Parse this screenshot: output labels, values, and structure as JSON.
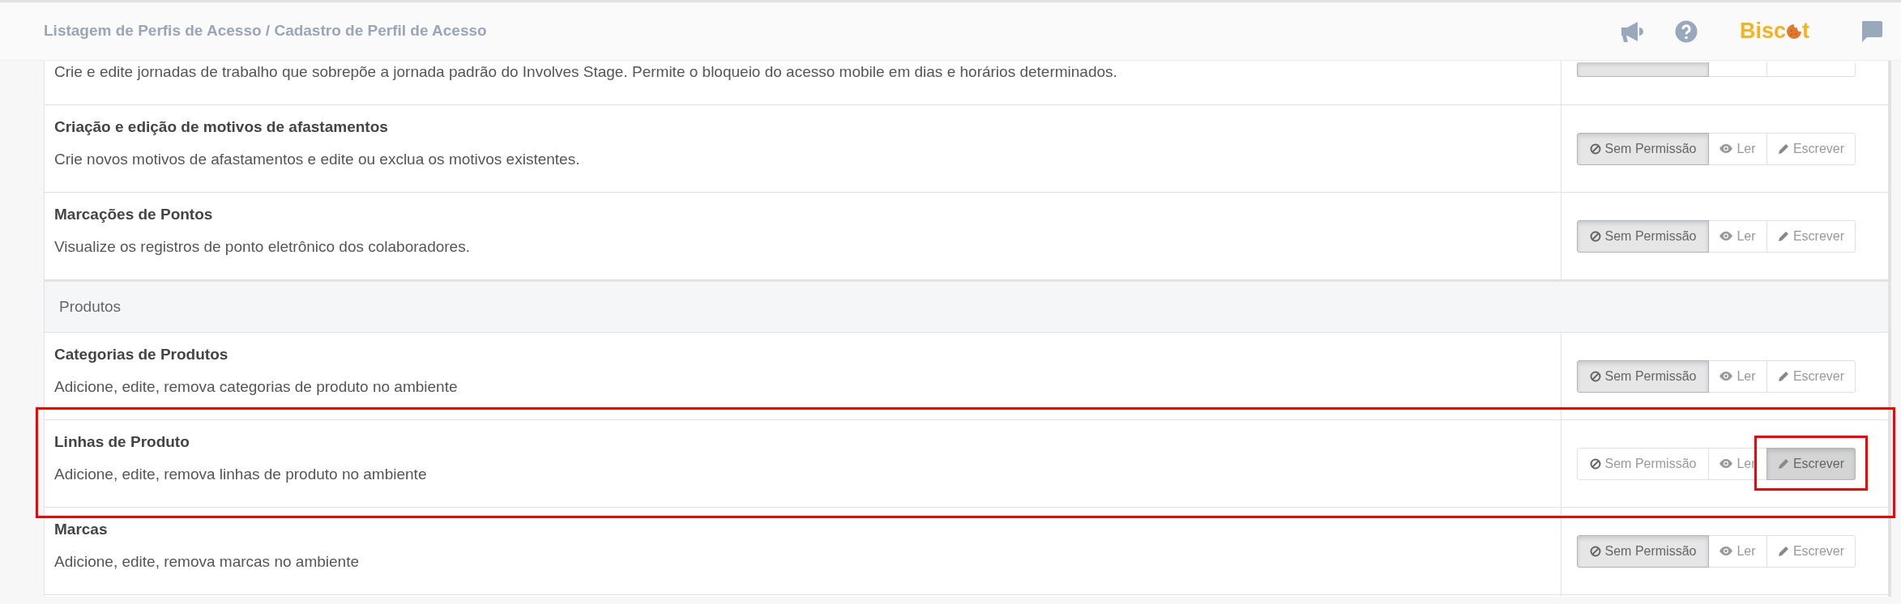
{
  "header": {
    "breadcrumb": "Listagem de Perfis de Acesso / Cadastro de Perfil de Acesso",
    "logo": {
      "before": "Bisc",
      "after": "t"
    }
  },
  "rows": [
    {
      "kind": "permission",
      "description": "Crie e edite jornadas de trabalho que sobrepõe a jornada padrão do Involves Stage. Permite o bloqueio do acesso mobile em dias e horários determinados.",
      "highlighted": false,
      "options": [
        {
          "kind": "none",
          "selected": true
        },
        {
          "kind": "read",
          "selected": false
        },
        {
          "kind": "write",
          "selected": false
        }
      ]
    },
    {
      "kind": "permission",
      "title": "Criação e edição de motivos de afastamentos",
      "description": "Crie novos motivos de afastamentos e edite ou exclua os motivos existentes.",
      "highlighted": false,
      "options": [
        {
          "kind": "none",
          "label": "Sem Permissão",
          "selected": true,
          "highlighted": false
        },
        {
          "kind": "read",
          "label": "Ler",
          "selected": false,
          "highlighted": false
        },
        {
          "kind": "write",
          "label": "Escrever",
          "selected": false,
          "highlighted": false
        }
      ]
    },
    {
      "kind": "permission",
      "title": "Marcações de Pontos",
      "description": "Visualize os registros de ponto eletrônico dos colaboradores.",
      "highlighted": false,
      "options": [
        {
          "kind": "none",
          "label": "Sem Permissão",
          "selected": true,
          "highlighted": false
        },
        {
          "kind": "read",
          "label": "Ler",
          "selected": false,
          "highlighted": false
        },
        {
          "kind": "write",
          "label": "Escrever",
          "selected": false,
          "highlighted": false
        }
      ]
    },
    {
      "kind": "section",
      "title": "Produtos"
    },
    {
      "kind": "permission",
      "title": "Categorias de Produtos",
      "description": "Adicione, edite, remova categorias de produto no ambiente",
      "highlighted": false,
      "options": [
        {
          "kind": "none",
          "label": "Sem Permissão",
          "selected": true,
          "highlighted": false
        },
        {
          "kind": "read",
          "label": "Ler",
          "selected": false,
          "highlighted": false
        },
        {
          "kind": "write",
          "label": "Escrever",
          "selected": false,
          "highlighted": false
        }
      ]
    },
    {
      "kind": "permission",
      "title": "Linhas de Produto",
      "description": "Adicione, edite, remova linhas de produto no ambiente",
      "highlighted": true,
      "options": [
        {
          "kind": "none",
          "label": "Sem Permissão",
          "selected": false,
          "highlighted": false
        },
        {
          "kind": "read",
          "label": "Ler",
          "selected": false,
          "highlighted": false
        },
        {
          "kind": "write",
          "label": "Escrever",
          "selected": true,
          "highlighted": true
        }
      ]
    },
    {
      "kind": "permission",
      "title": "Marcas",
      "description": "Adicione, edite, remova marcas no ambiente",
      "highlighted": false,
      "options": [
        {
          "kind": "none",
          "label": "Sem Permissão",
          "selected": true,
          "highlighted": false
        },
        {
          "kind": "read",
          "label": "Ler",
          "selected": false,
          "highlighted": false
        },
        {
          "kind": "write",
          "label": "Escrever",
          "selected": false,
          "highlighted": false
        }
      ]
    }
  ]
}
